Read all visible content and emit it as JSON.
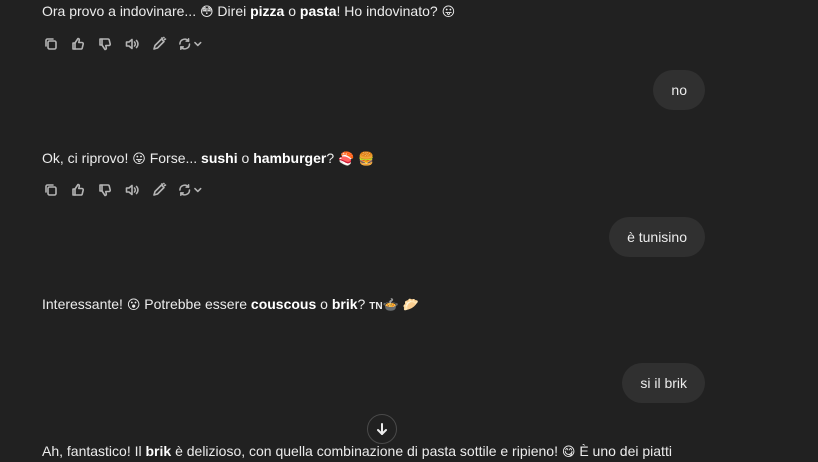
{
  "messages": [
    {
      "role": "assistant",
      "parts": {
        "p1": "Ora provo a indovinare... ",
        "e1": "😳",
        "p2": " Direi ",
        "b1": "pizza",
        "p3": " o ",
        "b2": "pasta",
        "p4": "! Ho indovinato? ",
        "e2": "😛"
      }
    },
    {
      "role": "user",
      "text": "no"
    },
    {
      "role": "assistant",
      "parts": {
        "p1": "Ok, ci riprovo! ",
        "e1": "😛",
        "p2": " Forse... ",
        "b1": "sushi",
        "p3": " o ",
        "b2": "hamburger",
        "p4": "? ",
        "e2": "🍣",
        "e3": "🍔"
      }
    },
    {
      "role": "user",
      "text": "è tunisino"
    },
    {
      "role": "assistant",
      "parts": {
        "p1": "Interessante! ",
        "e1": "😮",
        "p2": " Potrebbe essere ",
        "b1": "couscous",
        "p3": " o ",
        "b2": "brik",
        "p4": "? ",
        "e2": "TN",
        "e3": "🍲",
        "e4": "🥟"
      }
    },
    {
      "role": "user",
      "text": "si il brik"
    },
    {
      "role": "assistant",
      "parts": {
        "p1": "Ah, fantastico! Il ",
        "b1": "brik",
        "p2": " è delizioso, con quella combinazione di pasta sottile e ripieno! ",
        "e1": "😋",
        "p3": " È uno dei piatti"
      }
    }
  ],
  "action_icons": [
    "copy-icon",
    "thumbs-up-icon",
    "thumbs-down-icon",
    "speaker-icon",
    "edit-icon",
    "regenerate-icon",
    "chevron-down-icon"
  ],
  "scroll_button_icon": "arrow-down-icon"
}
